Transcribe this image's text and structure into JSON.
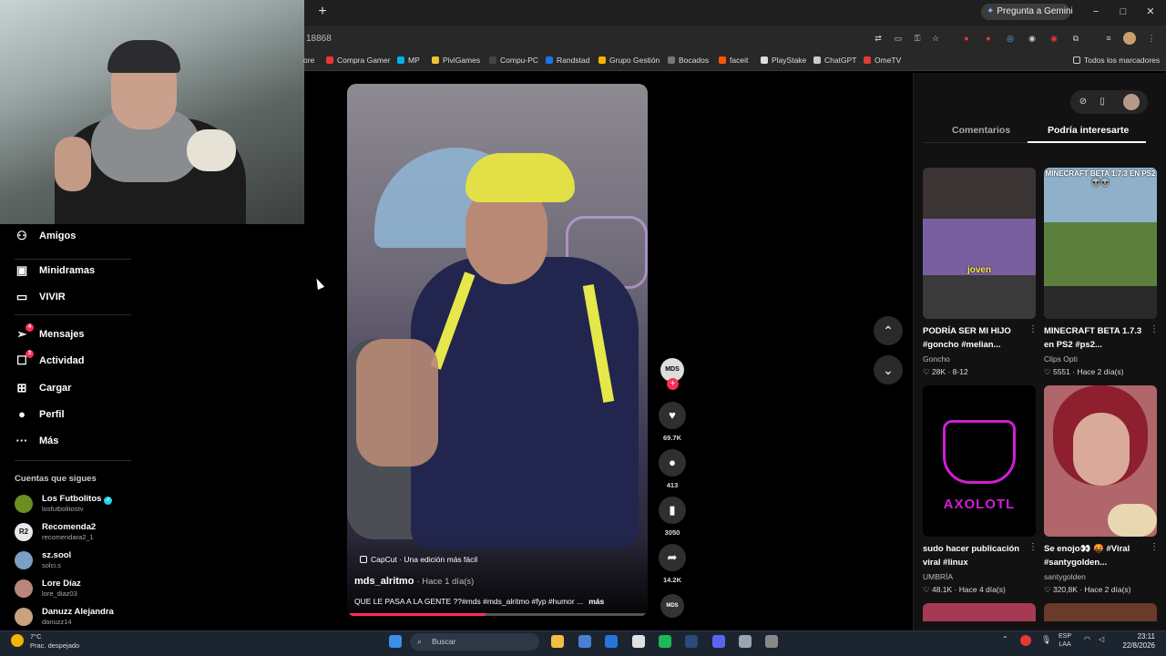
{
  "browser": {
    "new_tab": "+",
    "gemini_label": "Pregunta a Gemini",
    "url_fragment": "18868",
    "window_controls": [
      "−",
      "□",
      "✕"
    ],
    "bookmarks": [
      {
        "label": "ore",
        "color": "#555555"
      },
      {
        "label": "Compra Gamer",
        "color": "#e53935"
      },
      {
        "label": "MP",
        "color": "#00b1ea"
      },
      {
        "label": "PiviGames",
        "color": "#f1c232"
      },
      {
        "label": "Compu-PC",
        "color": "#444444"
      },
      {
        "label": "Randstad",
        "color": "#1a73e8"
      },
      {
        "label": "Grupo Gestión",
        "color": "#f4b400"
      },
      {
        "label": "Bocados",
        "color": "#777777"
      },
      {
        "label": "faceit",
        "color": "#ff5500"
      },
      {
        "label": "PlayStake",
        "color": "#dddddd"
      },
      {
        "label": "ChatGPT",
        "color": "#cccccc"
      },
      {
        "label": "OmeTV",
        "color": "#e53935"
      }
    ],
    "all_bookmarks": "Todos los marcadores"
  },
  "sidebar": {
    "items": [
      {
        "label": "Amigos",
        "icon": "friends-icon",
        "glyph": "⚇"
      },
      {
        "label": "Minidramas",
        "icon": "minidramas-icon",
        "glyph": "▣"
      },
      {
        "label": "VIVIR",
        "icon": "live-icon",
        "glyph": "▭"
      },
      {
        "label": "Mensajes",
        "icon": "messages-icon",
        "glyph": "➢",
        "badge": "4"
      },
      {
        "label": "Actividad",
        "icon": "activity-icon",
        "glyph": "☐",
        "badge": "3"
      },
      {
        "label": "Cargar",
        "icon": "upload-icon",
        "glyph": "⊞"
      },
      {
        "label": "Perfil",
        "icon": "profile-icon",
        "glyph": "●"
      },
      {
        "label": "Más",
        "icon": "more-icon",
        "glyph": "···"
      }
    ],
    "following_heading": "Cuentas que sigues",
    "following": [
      {
        "name": "Los Futbolitos",
        "user": "losfutbolitostv",
        "verified": true,
        "color": "#6b8e23"
      },
      {
        "name": "Recomenda2",
        "user": "recomendara2_1",
        "verified": false,
        "color": "#e8e8e8"
      },
      {
        "name": "sz.sool",
        "user": "solci.s",
        "verified": false,
        "color": "#7aa0c4"
      },
      {
        "name": "Lore Díaz",
        "user": "lore_diaz03",
        "verified": false,
        "color": "#b8867a"
      },
      {
        "name": "Danuzz Alejandra",
        "user": "danuzz14",
        "verified": false,
        "color": "#c9a27e"
      }
    ],
    "r2_text": "R2"
  },
  "video": {
    "capcut": "CapCut · Una edición más fácil",
    "author": "mds_alritmo",
    "time": "· Hace 1 día(s)",
    "description": "QUE LE PASA A LA GENTE ??#mds #mds_alritmo #fyp #humor ...",
    "more": "más",
    "progress": 0.46,
    "avatar_text": "MDS"
  },
  "actions": {
    "likes": "69.7K",
    "comments": "413",
    "saves": "3050",
    "shares": "14.2K",
    "follow_glyph": "+",
    "like_glyph": "♥",
    "comment_glyph": "●",
    "save_glyph": "▮",
    "share_glyph": "➦",
    "up_glyph": "⌃",
    "down_glyph": "⌄"
  },
  "panel": {
    "tab_comments": "Comentarios",
    "tab_interest": "Podría interesarte",
    "cards": [
      {
        "title": "PODRÍA SER MI HIJO #goncho #melian...",
        "author": "Goncho",
        "stats": "♡ 28K · 8-12",
        "overlay": "joven",
        "thumb_color": "#5a4a6a"
      },
      {
        "title": "MINECRAFT BETA 1.7.3 en PS2 #ps2...",
        "author": "Clips Opti",
        "stats": "♡ 5551 · Hace 2 día(s)",
        "overlay": "MINECRAFT BETA 1.7.3 EN PS2 👽👽",
        "thumb_color": "#5c7f3e"
      },
      {
        "title": "sudo hacer publicación viral #linux",
        "author": "UMBRÍA",
        "stats": "♡ 48.1K · Hace 4 día(s)",
        "overlay": "AXOLOTL",
        "thumb_color": "#000000"
      },
      {
        "title": "Se enojo👀 🤬 #Viral #santygolden...",
        "author": "santygolden",
        "stats": "♡ 320,8K · Hace 2 día(s)",
        "overlay": "",
        "thumb_color": "#b0666a"
      }
    ],
    "dots": "⋮"
  },
  "taskbar": {
    "temp": "7°C",
    "weather": "Prac. despejado",
    "search": "Buscar",
    "lang1": "ESP",
    "lang2": "LAA",
    "time": "23:11",
    "date": "22/8/2026",
    "apps": [
      {
        "name": "windows-start-icon",
        "color": "#3a8fe8"
      },
      {
        "name": "file-explorer-icon",
        "color": "#f0c040"
      },
      {
        "name": "store-icon",
        "color": "#4a7fd6"
      },
      {
        "name": "outlook-icon",
        "color": "#2476d8"
      },
      {
        "name": "chrome-icon",
        "color": "#e0e0e0"
      },
      {
        "name": "spotify-icon",
        "color": "#1db954"
      },
      {
        "name": "steam-icon",
        "color": "#2a4a78"
      },
      {
        "name": "discord-icon",
        "color": "#5865f2"
      },
      {
        "name": "settings-icon",
        "color": "#9aa4b2"
      },
      {
        "name": "app-icon",
        "color": "#888888"
      }
    ]
  }
}
